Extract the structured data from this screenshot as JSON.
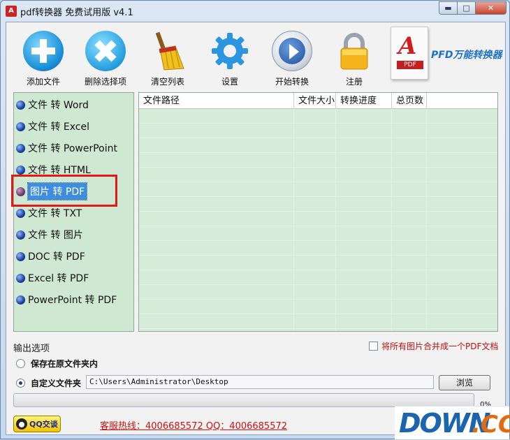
{
  "window": {
    "title": "pdf转换器 免费试用版 v4.1",
    "controls": {
      "minimize": "▬",
      "maximize": "□",
      "close": "✕"
    }
  },
  "toolbar": {
    "items": [
      {
        "label": "添加文件",
        "icon": "plus-circle-icon"
      },
      {
        "label": "删除选择项",
        "icon": "x-circle-icon"
      },
      {
        "label": "清空列表",
        "icon": "broom-icon"
      },
      {
        "label": "设置",
        "icon": "gear-icon"
      },
      {
        "label": "开始转换",
        "icon": "play-icon"
      },
      {
        "label": "注册",
        "icon": "lock-icon"
      }
    ],
    "logo": {
      "tag": "PDF",
      "brand": "PFD万能转换器"
    }
  },
  "menu": {
    "items": [
      {
        "label": "文件 转 Word"
      },
      {
        "label": "文件 转 Excel"
      },
      {
        "label": "文件 转 PowerPoint"
      },
      {
        "label": "文件 转 HTML"
      },
      {
        "label": "图片 转 PDF",
        "selected": true
      },
      {
        "label": "文件 转 TXT"
      },
      {
        "label": "文件 转 图片"
      },
      {
        "label": "DOC 转 PDF"
      },
      {
        "label": "Excel 转 PDF"
      },
      {
        "label": "PowerPoint 转 PDF"
      }
    ]
  },
  "table": {
    "columns": [
      "文件路径",
      "文件大小",
      "转换进度",
      "总页数"
    ]
  },
  "output": {
    "title": "输出选项",
    "merge_label": "将所有图片合并成一个PDF文档",
    "option_original": "保存在原文件夹内",
    "option_custom": "自定义文件夹",
    "selected_option": "custom",
    "path": "C:\\Users\\Administrator\\Desktop",
    "browse_label": "浏览"
  },
  "progress": {
    "value": 0,
    "text": "0%"
  },
  "footer": {
    "qq_label": "QQ交谈",
    "hotline": "客服热线：4006685572 QQ：4006685572"
  },
  "watermark": {
    "down": "DOWN",
    "cc": ".CC"
  },
  "colors": {
    "panel_green": "#cfe8d2",
    "table_green": "#d6ecd8",
    "selected_blue": "#3f8ede",
    "highlight_red": "#e01818",
    "hotline_red": "#d01010"
  }
}
